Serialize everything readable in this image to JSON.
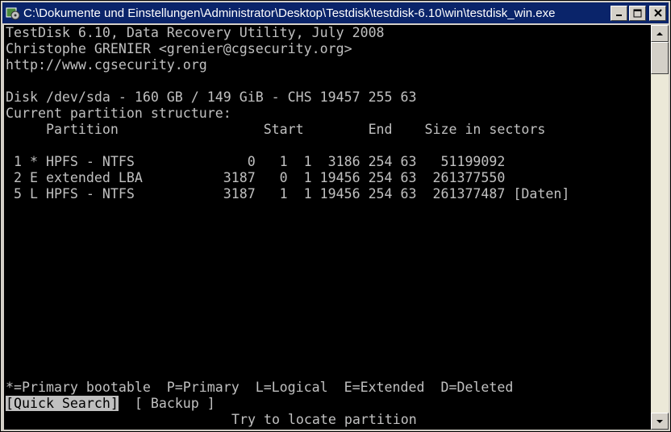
{
  "window": {
    "title": "C:\\Dokumente und Einstellungen\\Administrator\\Desktop\\Testdisk\\testdisk-6.10\\win\\testdisk_win.exe",
    "icons": {
      "app": "testdisk-app-icon",
      "minimize": "minimize-icon",
      "maximize": "maximize-icon",
      "close": "close-icon"
    }
  },
  "console": {
    "header": [
      "TestDisk 6.10, Data Recovery Utility, July 2008",
      "Christophe GRENIER <grenier@cgsecurity.org>",
      "http://www.cgsecurity.org"
    ],
    "disk_info": "Disk /dev/sda - 160 GB / 149 GiB - CHS 19457 255 63",
    "structure_label": "Current partition structure:",
    "table_header": "     Partition                  Start        End    Size in sectors",
    "partitions": [
      " 1 * HPFS - NTFS              0   1  1  3186 254 63   51199092",
      " 2 E extended LBA          3187   0  1 19456 254 63  261377550",
      " 5 L HPFS - NTFS           3187   1  1 19456 254 63  261377487 [Daten]"
    ],
    "legend": "*=Primary bootable  P=Primary  L=Logical  E=Extended  D=Deleted",
    "menu": {
      "quick_search": "[Quick Search]",
      "backup": "[ Backup ]"
    },
    "hint": "Try to locate partition"
  },
  "scrollbar": {
    "up_icon": "scroll-up-arrow-icon",
    "down_icon": "scroll-down-arrow-icon"
  }
}
